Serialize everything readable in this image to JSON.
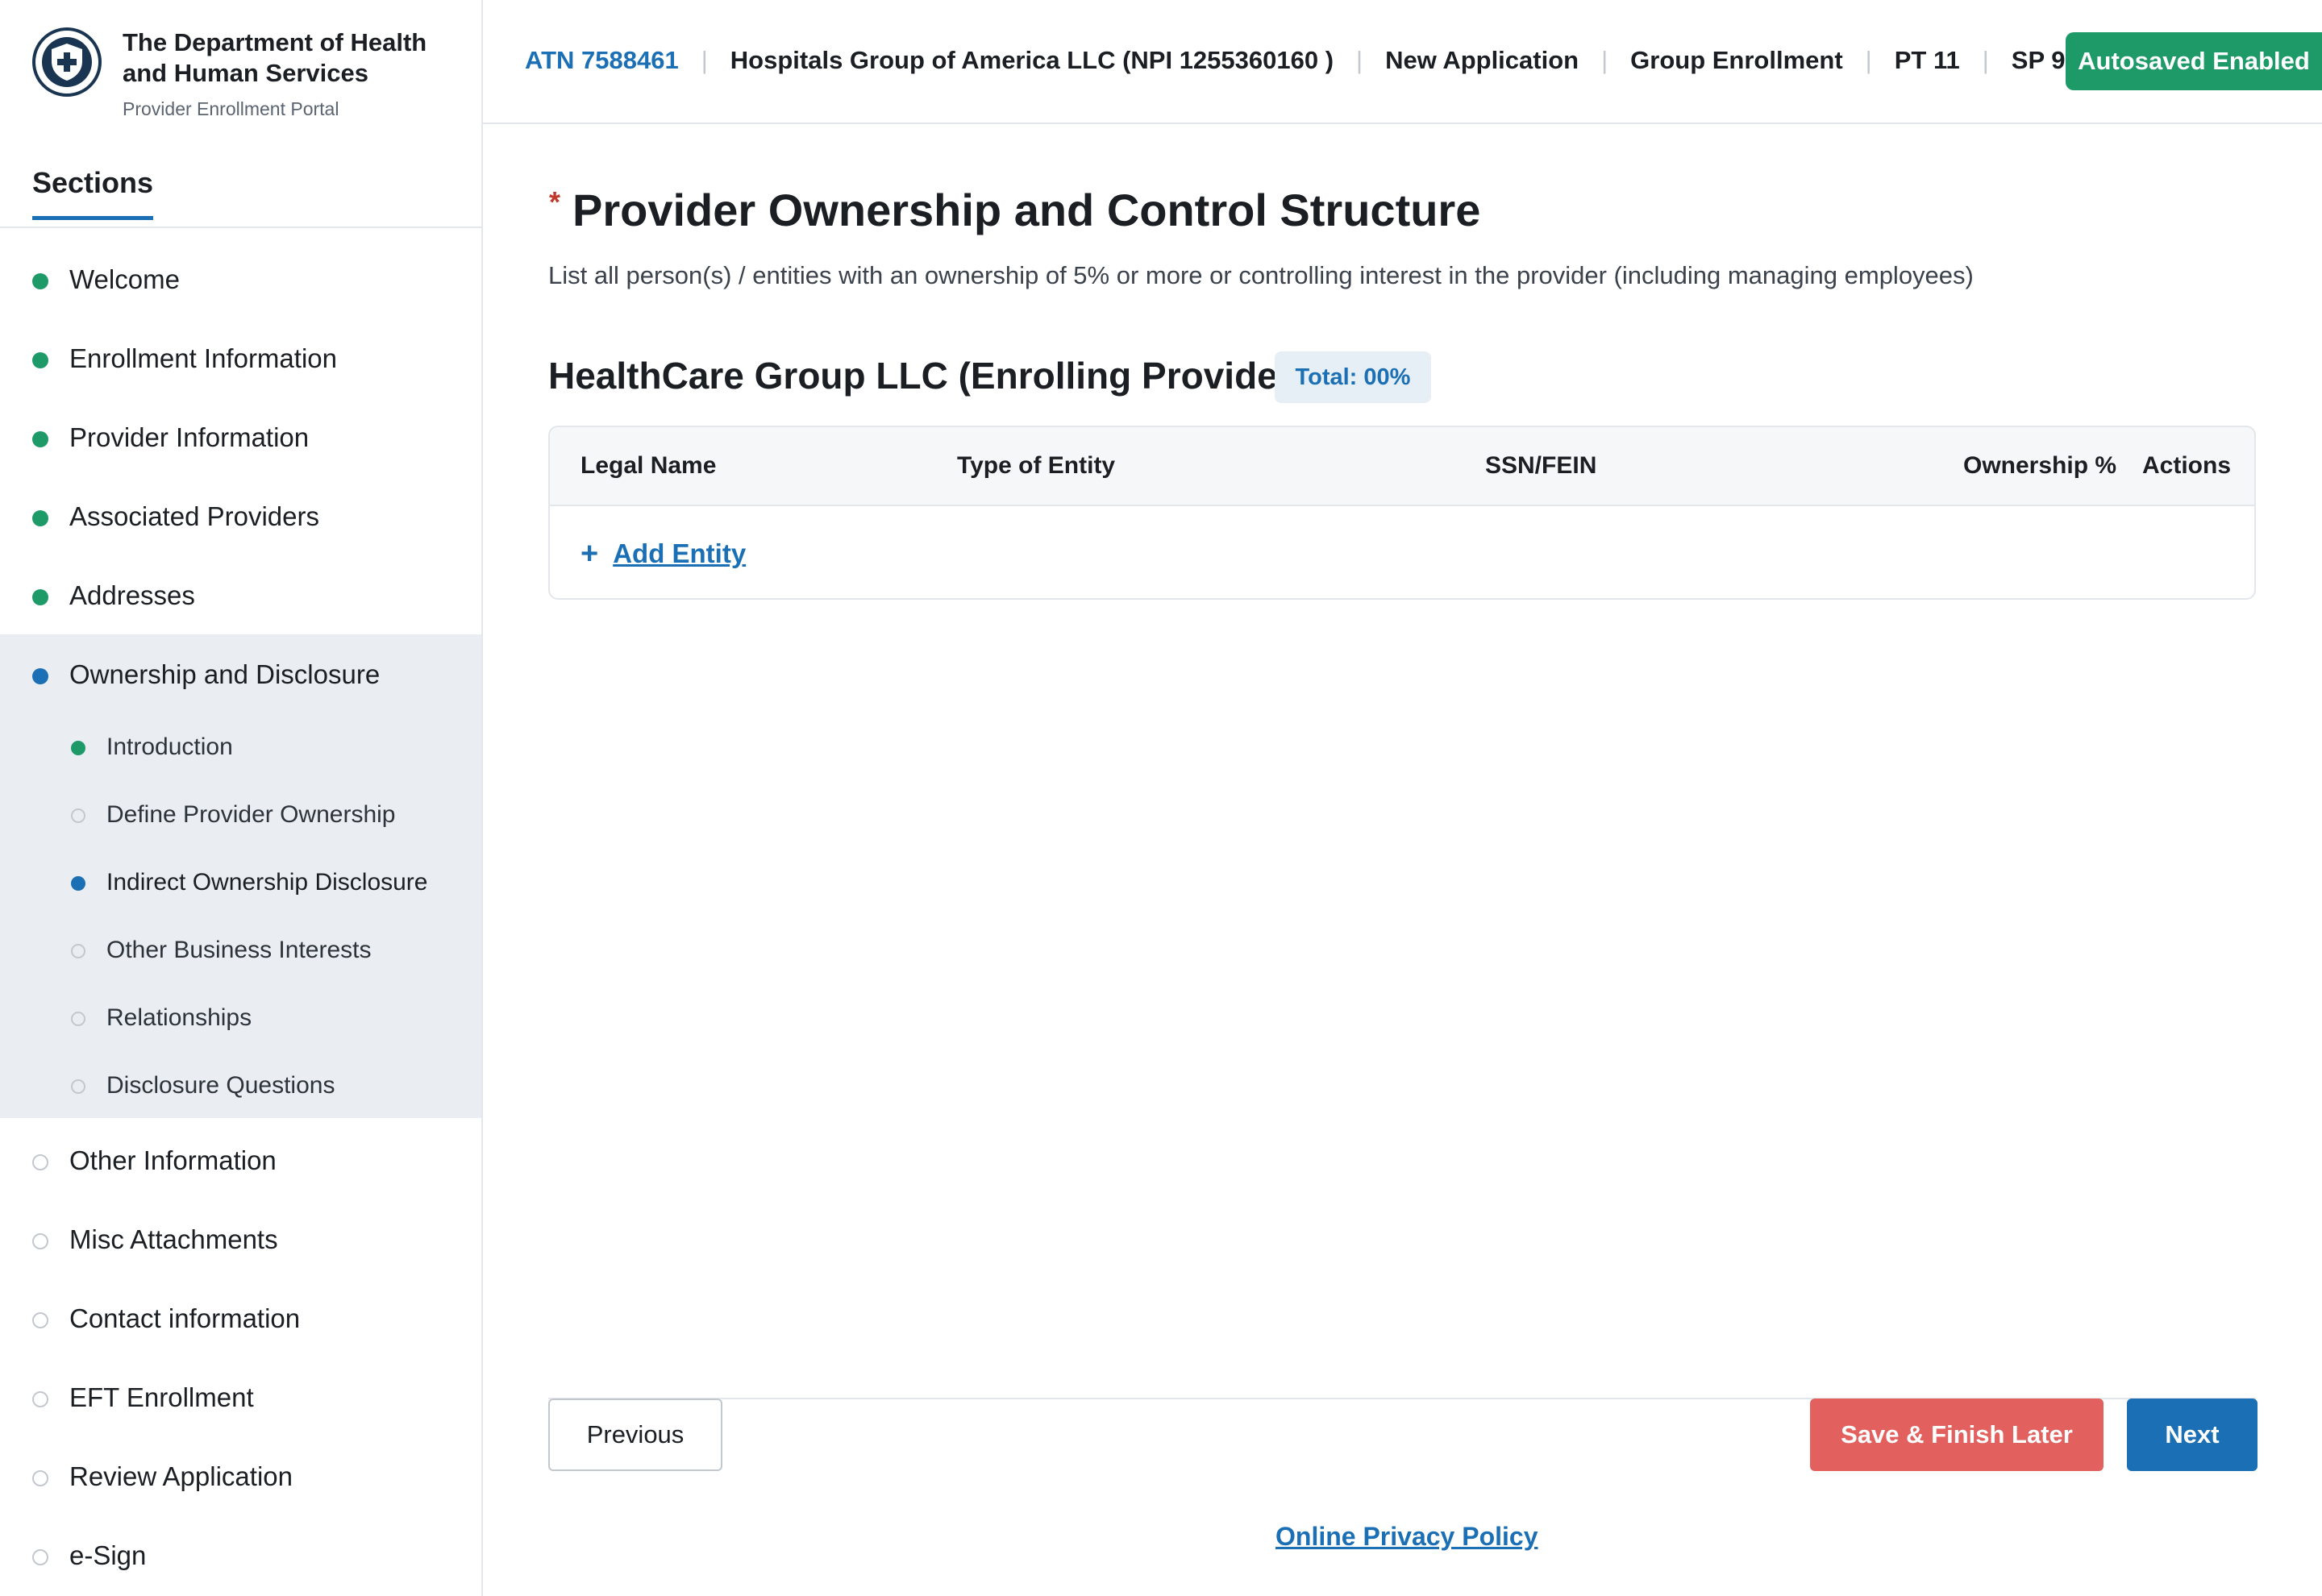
{
  "brand": {
    "title": "The Department of Health and Human Services",
    "subtitle": "Provider Enrollment Portal",
    "logo_icon": "shield-cross-icon"
  },
  "sidebar": {
    "tab_label": "Sections",
    "items": [
      {
        "label": "Welcome",
        "status": "complete"
      },
      {
        "label": "Enrollment Information",
        "status": "complete"
      },
      {
        "label": "Provider Information",
        "status": "complete"
      },
      {
        "label": "Associated Providers",
        "status": "complete"
      },
      {
        "label": "Addresses",
        "status": "complete"
      },
      {
        "label": "Ownership and Disclosure",
        "status": "current"
      },
      {
        "label": "Other Information",
        "status": "incomplete"
      },
      {
        "label": "Misc Attachments",
        "status": "incomplete"
      },
      {
        "label": "Contact information",
        "status": "incomplete"
      },
      {
        "label": "EFT Enrollment",
        "status": "incomplete"
      },
      {
        "label": "Review Application",
        "status": "incomplete"
      },
      {
        "label": "e-Sign",
        "status": "incomplete"
      }
    ],
    "subitems": [
      {
        "label": "Introduction",
        "status": "complete"
      },
      {
        "label": "Define Provider Ownership",
        "status": "incomplete"
      },
      {
        "label": "Indirect Ownership Disclosure",
        "status": "current"
      },
      {
        "label": "Other Business Interests",
        "status": "incomplete"
      },
      {
        "label": "Relationships",
        "status": "incomplete"
      },
      {
        "label": "Disclosure Questions",
        "status": "incomplete"
      }
    ]
  },
  "header": {
    "atn": "ATN 7588461",
    "organization": "Hospitals Group of America LLC (NPI 1255360160 )",
    "application_type": "New Application",
    "enrollment_type": "Group Enrollment",
    "pt": "PT 11",
    "sp": "SP 911",
    "autosave": "Autosaved Enabled"
  },
  "main": {
    "required_marker": "*",
    "title": "Provider Ownership and Control Structure",
    "description": "List all person(s) / entities with an ownership of 5% or more or controlling interest in the provider (including managing employees)",
    "group_title": "HealthCare Group LLC (Enrolling Provider)",
    "total_badge": "Total: 00%",
    "table": {
      "columns": [
        "Legal Name",
        "Type of Entity",
        "SSN/FEIN",
        "Ownership %",
        "Actions"
      ],
      "rows": [],
      "add_plus": "+",
      "add_label": "Add Entity"
    }
  },
  "footer": {
    "previous": "Previous",
    "save_later": "Save & Finish Later",
    "next": "Next",
    "privacy": "Online Privacy Policy"
  },
  "colors": {
    "primary": "#1b6fb5",
    "success": "#1e9a68",
    "danger": "#e2605e",
    "navy": "#1a3552"
  }
}
